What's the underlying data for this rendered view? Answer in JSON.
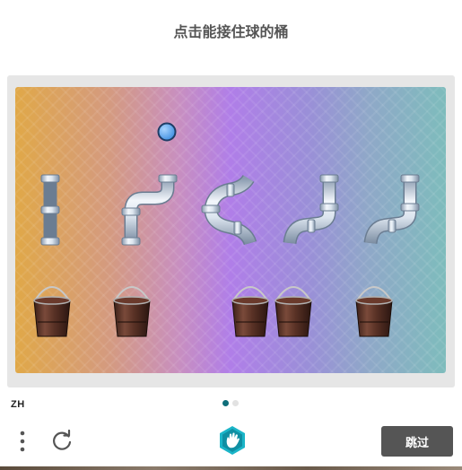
{
  "page": {
    "title": "点击能接住球的桶"
  },
  "puzzle": {
    "pipes": [
      "straight",
      "s-curve-right",
      "loop-left",
      "hook-left",
      "hook-left"
    ],
    "buckets": 5,
    "ball_color": "#5aa8f0"
  },
  "footer": {
    "language": "ZH",
    "page_indicator": {
      "total": 2,
      "current": 1
    },
    "skip_label": "跳过"
  },
  "colors": {
    "accent": "#0f6e7a",
    "button_bg": "#555555",
    "logo": "#1bb5c8"
  },
  "icons": {
    "menu": "vertical-dots-icon",
    "refresh": "refresh-icon",
    "logo": "hand-icon"
  }
}
